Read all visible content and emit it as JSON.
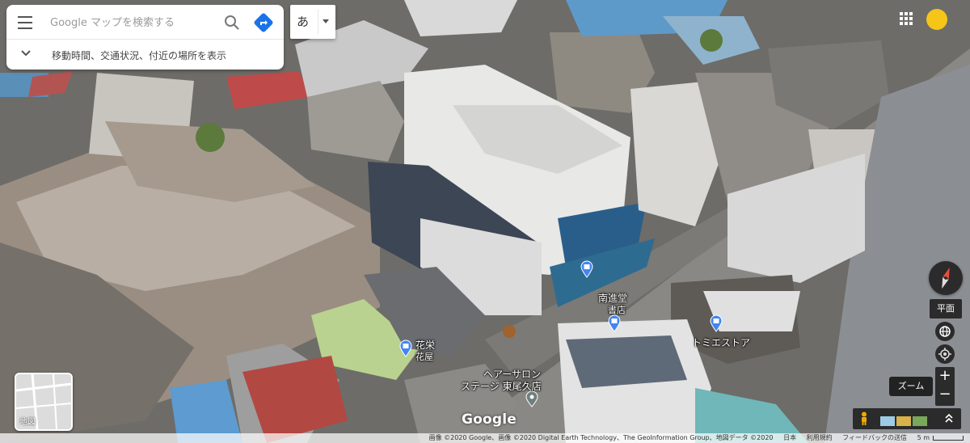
{
  "search": {
    "placeholder": "Google マップを検索する",
    "expand_label": "移動時間、交通状況、付近の場所を表示"
  },
  "ime": {
    "label": "あ"
  },
  "places": [
    {
      "name": "南進堂",
      "sub": "書店"
    },
    {
      "name": "トミエストア",
      "sub": ""
    },
    {
      "name": "花栄",
      "sub": "花屋"
    },
    {
      "name": "ヘアーサロン",
      "sub": "ステージ 東尾久店"
    }
  ],
  "controls": {
    "tilt_label": "平面",
    "zoom_tooltip": "ズーム",
    "zoom_in": "+",
    "zoom_out": "−"
  },
  "layer": {
    "label": "地図"
  },
  "logo": "Google",
  "attribution": {
    "imagery": "画像 ©2020 Google、画像 ©2020 Digital Earth Technology、The GeoInformation Group、地図データ ©2020",
    "region": "日本",
    "terms": "利用規約",
    "feedback": "フィードバックの送信",
    "scale": "5 m"
  },
  "colors": {
    "accent_blue": "#1a73e8",
    "avatar": "#f5c518",
    "pin_blue": "#4285f4",
    "pin_gray": "#6f7f7f"
  },
  "icons": [
    "menu-icon",
    "search-icon",
    "directions-icon",
    "chevron-down-icon",
    "apps-icon",
    "compass-icon",
    "globe-icon",
    "my-location-icon",
    "pegman-icon",
    "store-pin-icon",
    "place-pin-icon"
  ]
}
